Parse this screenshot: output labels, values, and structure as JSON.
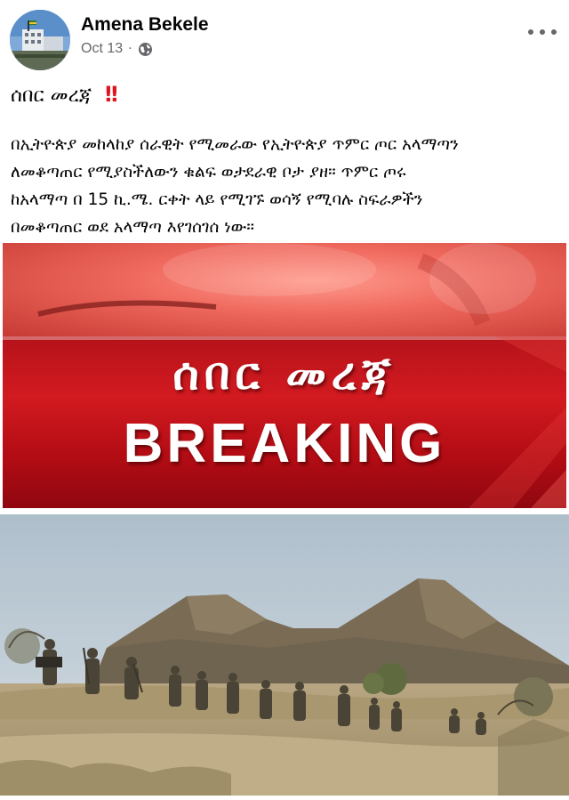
{
  "post": {
    "author_name": "Amena Bekele",
    "date": "Oct 13",
    "separator": "·",
    "visibility_icon": "globe-icon",
    "headline": "ሰበር መረጃ",
    "headline_icon": "‼️",
    "body": "በኢትዮጵያ መከላከያ ሰራዊት የሚመራው የኢትዮጵያ ጥምር ጦር አላማጣን\nለመቆጣጠር የሚያስችለውን ቁልፍ ወታደራዊ ቦታ ያዘ። ጥምር ጦሩ\nከአላማጣ በ 15 ኪ.ሜ. ርቀት ላይ የሚገኙ ወሳኝ የሚባሉ ስፍራዎችን\nበመቆጣጠር ወደ አላማጣ እየገሰገሰ ነው።"
  },
  "images": {
    "breaking": {
      "amharic_text": "ሰበር መረጃ",
      "english_text": "BREAKING",
      "colors": {
        "band": "#c8151c",
        "text": "#ffffff"
      }
    },
    "soldiers": {
      "description_icon": "landscape-photo"
    }
  },
  "colors": {
    "text_primary": "#050505",
    "text_secondary": "#65676b",
    "alert_red": "#e0141e"
  }
}
